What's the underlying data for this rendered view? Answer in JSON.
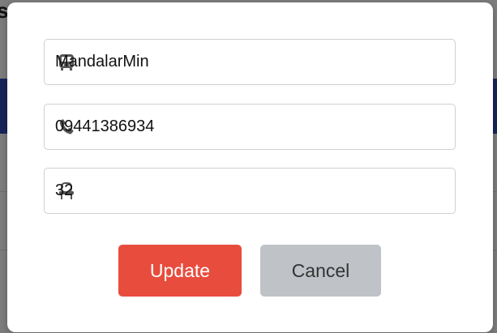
{
  "background": {
    "heading_fragment": "s"
  },
  "form": {
    "name_field": {
      "value": "MandalarMin",
      "icon": "bus-icon"
    },
    "phone_field": {
      "value": "09441386934",
      "icon": "phone-icon"
    },
    "seat_field": {
      "value": "32",
      "icon": "seat-icon"
    }
  },
  "buttons": {
    "update_label": "Update",
    "cancel_label": "Cancel"
  },
  "colors": {
    "update_bg": "#e84c3d",
    "cancel_bg": "#bfc3c7",
    "overlay": "#7d7d7d",
    "nav_band": "#18255a"
  }
}
